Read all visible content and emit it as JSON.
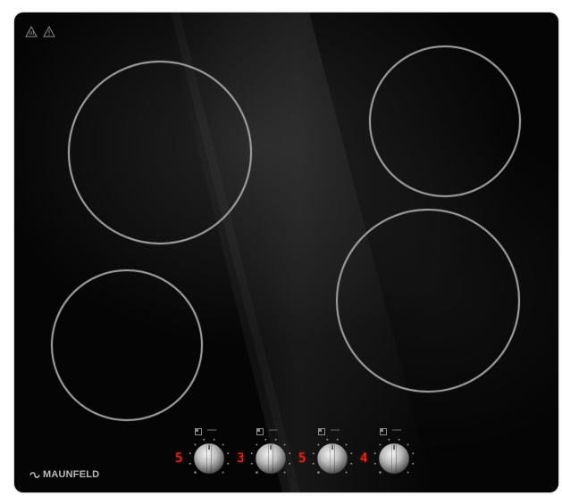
{
  "brand": {
    "name": "MAUNFELD",
    "color": "#b9b9b9"
  },
  "hob": {
    "surface_color": "#050505",
    "zone_ring_color": "#9a9a9a"
  },
  "warning_icons": [
    "hot-surface-warning-icon",
    "caution-triangle-icon"
  ],
  "controls": [
    {
      "digit": "5",
      "icon": "zone-selector-icon"
    },
    {
      "digit": "3",
      "icon": "zone-selector-icon"
    },
    {
      "digit": "5",
      "icon": "zone-selector-icon"
    },
    {
      "digit": "4",
      "icon": "zone-selector-icon"
    }
  ],
  "display_color": "#ff2a1c"
}
